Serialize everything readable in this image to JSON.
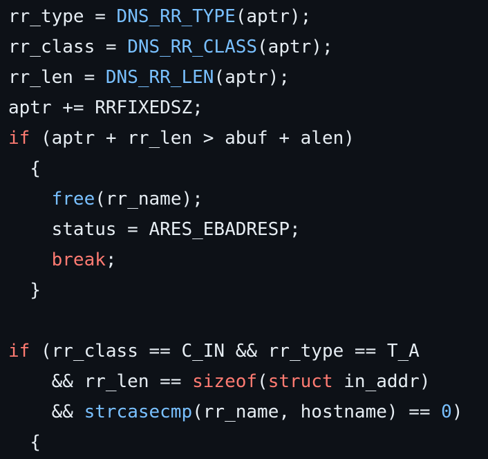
{
  "code": {
    "lines": [
      {
        "tokens": [
          {
            "t": "rr_type = ",
            "k": "plain"
          },
          {
            "t": "DNS_RR_TYPE",
            "k": "fn"
          },
          {
            "t": "(aptr);",
            "k": "plain"
          }
        ]
      },
      {
        "tokens": [
          {
            "t": "rr_class = ",
            "k": "plain"
          },
          {
            "t": "DNS_RR_CLASS",
            "k": "fn"
          },
          {
            "t": "(aptr);",
            "k": "plain"
          }
        ]
      },
      {
        "tokens": [
          {
            "t": "rr_len = ",
            "k": "plain"
          },
          {
            "t": "DNS_RR_LEN",
            "k": "fn"
          },
          {
            "t": "(aptr);",
            "k": "plain"
          }
        ]
      },
      {
        "tokens": [
          {
            "t": "aptr += RRFIXEDSZ;",
            "k": "plain"
          }
        ]
      },
      {
        "tokens": [
          {
            "t": "if",
            "k": "kw"
          },
          {
            "t": " (aptr + rr_len > abuf + alen)",
            "k": "plain"
          }
        ]
      },
      {
        "tokens": [
          {
            "t": "  {",
            "k": "plain"
          }
        ]
      },
      {
        "tokens": [
          {
            "t": "    ",
            "k": "plain"
          },
          {
            "t": "free",
            "k": "fn"
          },
          {
            "t": "(rr_name);",
            "k": "plain"
          }
        ]
      },
      {
        "tokens": [
          {
            "t": "    status = ARES_EBADRESP;",
            "k": "plain"
          }
        ]
      },
      {
        "tokens": [
          {
            "t": "    ",
            "k": "plain"
          },
          {
            "t": "break",
            "k": "kw"
          },
          {
            "t": ";",
            "k": "plain"
          }
        ]
      },
      {
        "tokens": [
          {
            "t": "  }",
            "k": "plain"
          }
        ]
      },
      {
        "tokens": []
      },
      {
        "tokens": [
          {
            "t": "if",
            "k": "kw"
          },
          {
            "t": " (rr_class == C_IN && rr_type == T_A",
            "k": "plain"
          }
        ]
      },
      {
        "tokens": [
          {
            "t": "    && rr_len == ",
            "k": "plain"
          },
          {
            "t": "sizeof",
            "k": "kw"
          },
          {
            "t": "(",
            "k": "plain"
          },
          {
            "t": "struct",
            "k": "kw"
          },
          {
            "t": " in_addr)",
            "k": "plain"
          }
        ]
      },
      {
        "tokens": [
          {
            "t": "    && ",
            "k": "plain"
          },
          {
            "t": "strcasecmp",
            "k": "fn"
          },
          {
            "t": "(rr_name, hostname) == ",
            "k": "plain"
          },
          {
            "t": "0",
            "k": "num"
          },
          {
            "t": ")",
            "k": "plain"
          }
        ]
      },
      {
        "tokens": [
          {
            "t": "  {",
            "k": "plain"
          }
        ]
      }
    ]
  },
  "colors": {
    "background": "#0d1117",
    "plain": "#e6edf3",
    "function": "#79c0ff",
    "keyword": "#ff7b72",
    "number": "#79c0ff"
  }
}
